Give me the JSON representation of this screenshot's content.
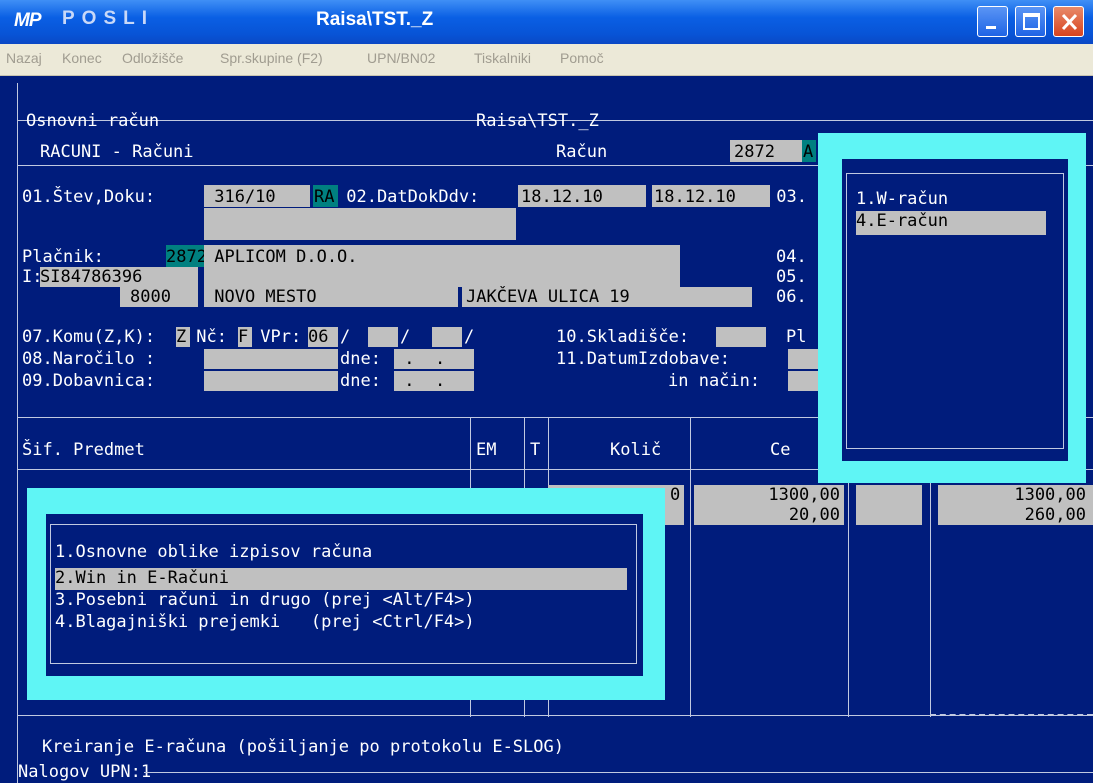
{
  "window": {
    "icon_text": "MP",
    "app_name": "POSLI",
    "doc_title": "Raisa\\TST._Z"
  },
  "menu": [
    "Nazaj",
    "Konec",
    "Odložišče",
    "Spr.skupine (F2)",
    "UPN/BN02",
    "Tiskalniki",
    "Pomoč"
  ],
  "header": {
    "frame_left": "Osnovni račun",
    "frame_center": "Raisa\\TST._Z",
    "module": "RACUNI - Računi",
    "doc_label": "Račun",
    "doc_number": "2872",
    "doc_flag": "A"
  },
  "form": {
    "f01_label": "01.Štev,Doku:",
    "f01_value": " 316/10",
    "f01_type": "RA",
    "f02_label": " 02.DatDokDdv:",
    "f02_date1": "18.12.10",
    "f02_date2": "18.12.10",
    "f03_label": " 03.",
    "payer_label": "Plačnik:",
    "payer_code": "2872",
    "payer_name": " APLICOM D.O.O.",
    "f04_label": "04.",
    "vat_label": "I:",
    "vat_value": "SI84786396",
    "f05_label": "05.",
    "postcode": "8000",
    "city": " NOVO MESTO",
    "street": "JAKČEVA ULICA 19",
    "f06_label": "06.",
    "f07_label": "07.Komu(Z,K):",
    "f07_value": "Z",
    "nc_label": " Nč:",
    "nc_value": "F",
    "vpr_label": " VPr:",
    "vpr_value": "06",
    "slash1": "/",
    "slash2": "/",
    "slash3": "/",
    "f10_label": "10.Skladišče:",
    "pl_label": "Pl",
    "f08_label": "08.Naročilo :",
    "dne1_label": "dne:",
    "dne1_value": " .  .",
    "f11_label": "11.DatumIzdobave:",
    "f09_label": "09.Dobavnica:",
    "dne2_label": "dne:",
    "dne2_value": " .  .",
    "nacin_label": "in način:"
  },
  "table": {
    "headers": [
      "Šif. Predmet",
      "EM",
      "T",
      "Količ",
      "Ce"
    ],
    "rows": [
      {
        "qty_tail": "0",
        "price": "1300,00",
        "total": "1300,00"
      },
      {
        "qty_tail": "",
        "price": "20,00",
        "total": "260,00"
      }
    ]
  },
  "popup_main": {
    "items": [
      "1.Osnovne oblike izpisov računa",
      "2.Win in E-Računi",
      "3.Posebni računi in drugo (prej <Alt/F4>)",
      "4.Blagajniški prejemki   (prej <Ctrl/F4>)"
    ],
    "selected_index": 1
  },
  "popup_sub": {
    "items": [
      "1.W-račun",
      "4.E-račun"
    ],
    "selected_index": 1
  },
  "footer": {
    "hint": "Kreiranje E-računa (pošiljanje po protokolu E-SLOG)",
    "upn_label": "Nalogov UPN:1"
  },
  "colors": {
    "console_bg": "#001c7c",
    "field_bg": "#c0c0c0",
    "highlight_teal": "#008080",
    "popup_border": "#5ff5f5"
  }
}
